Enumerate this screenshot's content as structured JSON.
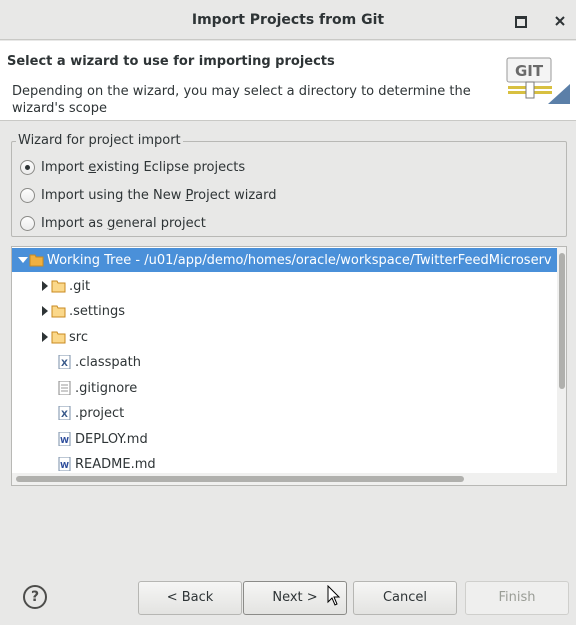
{
  "window": {
    "title": "Import Projects from Git"
  },
  "header": {
    "title": "Select a wizard to use for importing projects",
    "description": "Depending on the wizard, you may select a directory to determine the wizard's scope",
    "logo_text": "GIT"
  },
  "wizard_group": {
    "legend": "Wizard for project import",
    "options": [
      {
        "pre": "Import ",
        "mnemonic": "e",
        "post": "xisting Eclipse projects",
        "checked": true
      },
      {
        "pre": "Import using the New ",
        "mnemonic": "P",
        "post": "roject wizard",
        "checked": false
      },
      {
        "pre": "Import as ",
        "mnemonic": "g",
        "post": "eneral project",
        "checked": false
      }
    ]
  },
  "tree": {
    "root": "Working Tree - /u01/app/demo/homes/oracle/workspace/TwitterFeedMicroserv",
    "folders": [
      ".git",
      ".settings",
      "src"
    ],
    "files": [
      ".classpath",
      ".gitignore",
      ".project",
      "DEPLOY.md",
      "README.md"
    ]
  },
  "buttons": {
    "help": "?",
    "back": "< Back",
    "next": "Next >",
    "cancel": "Cancel",
    "finish": "Finish"
  },
  "colors": {
    "selection": "#4a90d9",
    "folder": "#f0b040",
    "background": "#e8e8e7"
  }
}
